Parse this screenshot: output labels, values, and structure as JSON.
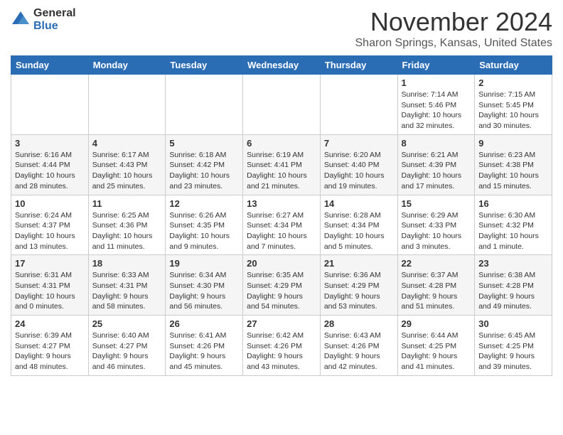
{
  "logo": {
    "general": "General",
    "blue": "Blue"
  },
  "header": {
    "month": "November 2024",
    "location": "Sharon Springs, Kansas, United States"
  },
  "weekdays": [
    "Sunday",
    "Monday",
    "Tuesday",
    "Wednesday",
    "Thursday",
    "Friday",
    "Saturday"
  ],
  "weeks": [
    [
      {
        "day": "",
        "info": ""
      },
      {
        "day": "",
        "info": ""
      },
      {
        "day": "",
        "info": ""
      },
      {
        "day": "",
        "info": ""
      },
      {
        "day": "",
        "info": ""
      },
      {
        "day": "1",
        "info": "Sunrise: 7:14 AM\nSunset: 5:46 PM\nDaylight: 10 hours\nand 32 minutes."
      },
      {
        "day": "2",
        "info": "Sunrise: 7:15 AM\nSunset: 5:45 PM\nDaylight: 10 hours\nand 30 minutes."
      }
    ],
    [
      {
        "day": "3",
        "info": "Sunrise: 6:16 AM\nSunset: 4:44 PM\nDaylight: 10 hours\nand 28 minutes."
      },
      {
        "day": "4",
        "info": "Sunrise: 6:17 AM\nSunset: 4:43 PM\nDaylight: 10 hours\nand 25 minutes."
      },
      {
        "day": "5",
        "info": "Sunrise: 6:18 AM\nSunset: 4:42 PM\nDaylight: 10 hours\nand 23 minutes."
      },
      {
        "day": "6",
        "info": "Sunrise: 6:19 AM\nSunset: 4:41 PM\nDaylight: 10 hours\nand 21 minutes."
      },
      {
        "day": "7",
        "info": "Sunrise: 6:20 AM\nSunset: 4:40 PM\nDaylight: 10 hours\nand 19 minutes."
      },
      {
        "day": "8",
        "info": "Sunrise: 6:21 AM\nSunset: 4:39 PM\nDaylight: 10 hours\nand 17 minutes."
      },
      {
        "day": "9",
        "info": "Sunrise: 6:23 AM\nSunset: 4:38 PM\nDaylight: 10 hours\nand 15 minutes."
      }
    ],
    [
      {
        "day": "10",
        "info": "Sunrise: 6:24 AM\nSunset: 4:37 PM\nDaylight: 10 hours\nand 13 minutes."
      },
      {
        "day": "11",
        "info": "Sunrise: 6:25 AM\nSunset: 4:36 PM\nDaylight: 10 hours\nand 11 minutes."
      },
      {
        "day": "12",
        "info": "Sunrise: 6:26 AM\nSunset: 4:35 PM\nDaylight: 10 hours\nand 9 minutes."
      },
      {
        "day": "13",
        "info": "Sunrise: 6:27 AM\nSunset: 4:34 PM\nDaylight: 10 hours\nand 7 minutes."
      },
      {
        "day": "14",
        "info": "Sunrise: 6:28 AM\nSunset: 4:34 PM\nDaylight: 10 hours\nand 5 minutes."
      },
      {
        "day": "15",
        "info": "Sunrise: 6:29 AM\nSunset: 4:33 PM\nDaylight: 10 hours\nand 3 minutes."
      },
      {
        "day": "16",
        "info": "Sunrise: 6:30 AM\nSunset: 4:32 PM\nDaylight: 10 hours\nand 1 minute."
      }
    ],
    [
      {
        "day": "17",
        "info": "Sunrise: 6:31 AM\nSunset: 4:31 PM\nDaylight: 10 hours\nand 0 minutes."
      },
      {
        "day": "18",
        "info": "Sunrise: 6:33 AM\nSunset: 4:31 PM\nDaylight: 9 hours\nand 58 minutes."
      },
      {
        "day": "19",
        "info": "Sunrise: 6:34 AM\nSunset: 4:30 PM\nDaylight: 9 hours\nand 56 minutes."
      },
      {
        "day": "20",
        "info": "Sunrise: 6:35 AM\nSunset: 4:29 PM\nDaylight: 9 hours\nand 54 minutes."
      },
      {
        "day": "21",
        "info": "Sunrise: 6:36 AM\nSunset: 4:29 PM\nDaylight: 9 hours\nand 53 minutes."
      },
      {
        "day": "22",
        "info": "Sunrise: 6:37 AM\nSunset: 4:28 PM\nDaylight: 9 hours\nand 51 minutes."
      },
      {
        "day": "23",
        "info": "Sunrise: 6:38 AM\nSunset: 4:28 PM\nDaylight: 9 hours\nand 49 minutes."
      }
    ],
    [
      {
        "day": "24",
        "info": "Sunrise: 6:39 AM\nSunset: 4:27 PM\nDaylight: 9 hours\nand 48 minutes."
      },
      {
        "day": "25",
        "info": "Sunrise: 6:40 AM\nSunset: 4:27 PM\nDaylight: 9 hours\nand 46 minutes."
      },
      {
        "day": "26",
        "info": "Sunrise: 6:41 AM\nSunset: 4:26 PM\nDaylight: 9 hours\nand 45 minutes."
      },
      {
        "day": "27",
        "info": "Sunrise: 6:42 AM\nSunset: 4:26 PM\nDaylight: 9 hours\nand 43 minutes."
      },
      {
        "day": "28",
        "info": "Sunrise: 6:43 AM\nSunset: 4:26 PM\nDaylight: 9 hours\nand 42 minutes."
      },
      {
        "day": "29",
        "info": "Sunrise: 6:44 AM\nSunset: 4:25 PM\nDaylight: 9 hours\nand 41 minutes."
      },
      {
        "day": "30",
        "info": "Sunrise: 6:45 AM\nSunset: 4:25 PM\nDaylight: 9 hours\nand 39 minutes."
      }
    ]
  ]
}
